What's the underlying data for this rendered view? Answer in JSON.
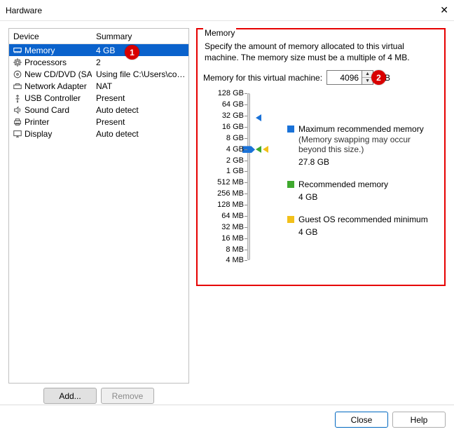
{
  "window": {
    "title": "Hardware"
  },
  "annotations": {
    "one": "1",
    "two": "2"
  },
  "device_list": {
    "headers": {
      "device": "Device",
      "summary": "Summary"
    },
    "rows": [
      {
        "icon": "memory",
        "name": "Memory",
        "summary": "4 GB",
        "selected": true
      },
      {
        "icon": "cpu",
        "name": "Processors",
        "summary": "2"
      },
      {
        "icon": "disc",
        "name": "New CD/DVD (SATA)",
        "summary": "Using file C:\\Users\\codru\\De..."
      },
      {
        "icon": "net",
        "name": "Network Adapter",
        "summary": "NAT"
      },
      {
        "icon": "usb",
        "name": "USB Controller",
        "summary": "Present"
      },
      {
        "icon": "sound",
        "name": "Sound Card",
        "summary": "Auto detect"
      },
      {
        "icon": "printer",
        "name": "Printer",
        "summary": "Present"
      },
      {
        "icon": "display",
        "name": "Display",
        "summary": "Auto detect"
      }
    ],
    "buttons": {
      "add": "Add...",
      "remove": "Remove"
    }
  },
  "memory_panel": {
    "group_title": "Memory",
    "description": "Specify the amount of memory allocated to this virtual machine. The memory size must be a multiple of 4 MB.",
    "input_label": "Memory for this virtual machine:",
    "input_value": "4096",
    "input_unit": "MB",
    "slider_ticks": [
      "128 GB",
      "64 GB",
      "32 GB",
      "16 GB",
      "8 GB",
      "4 GB",
      "2 GB",
      "1 GB",
      "512 MB",
      "256 MB",
      "128 MB",
      "64 MB",
      "32 MB",
      "16 MB",
      "8 MB",
      "4 MB"
    ],
    "legend": {
      "max": {
        "title": "Maximum recommended memory",
        "sub": "(Memory swapping may occur beyond this size.)",
        "value": "27.8 GB"
      },
      "rec": {
        "title": "Recommended memory",
        "value": "4 GB"
      },
      "guest": {
        "title": "Guest OS recommended minimum",
        "value": "4 GB"
      }
    }
  },
  "footer": {
    "close": "Close",
    "help": "Help"
  }
}
